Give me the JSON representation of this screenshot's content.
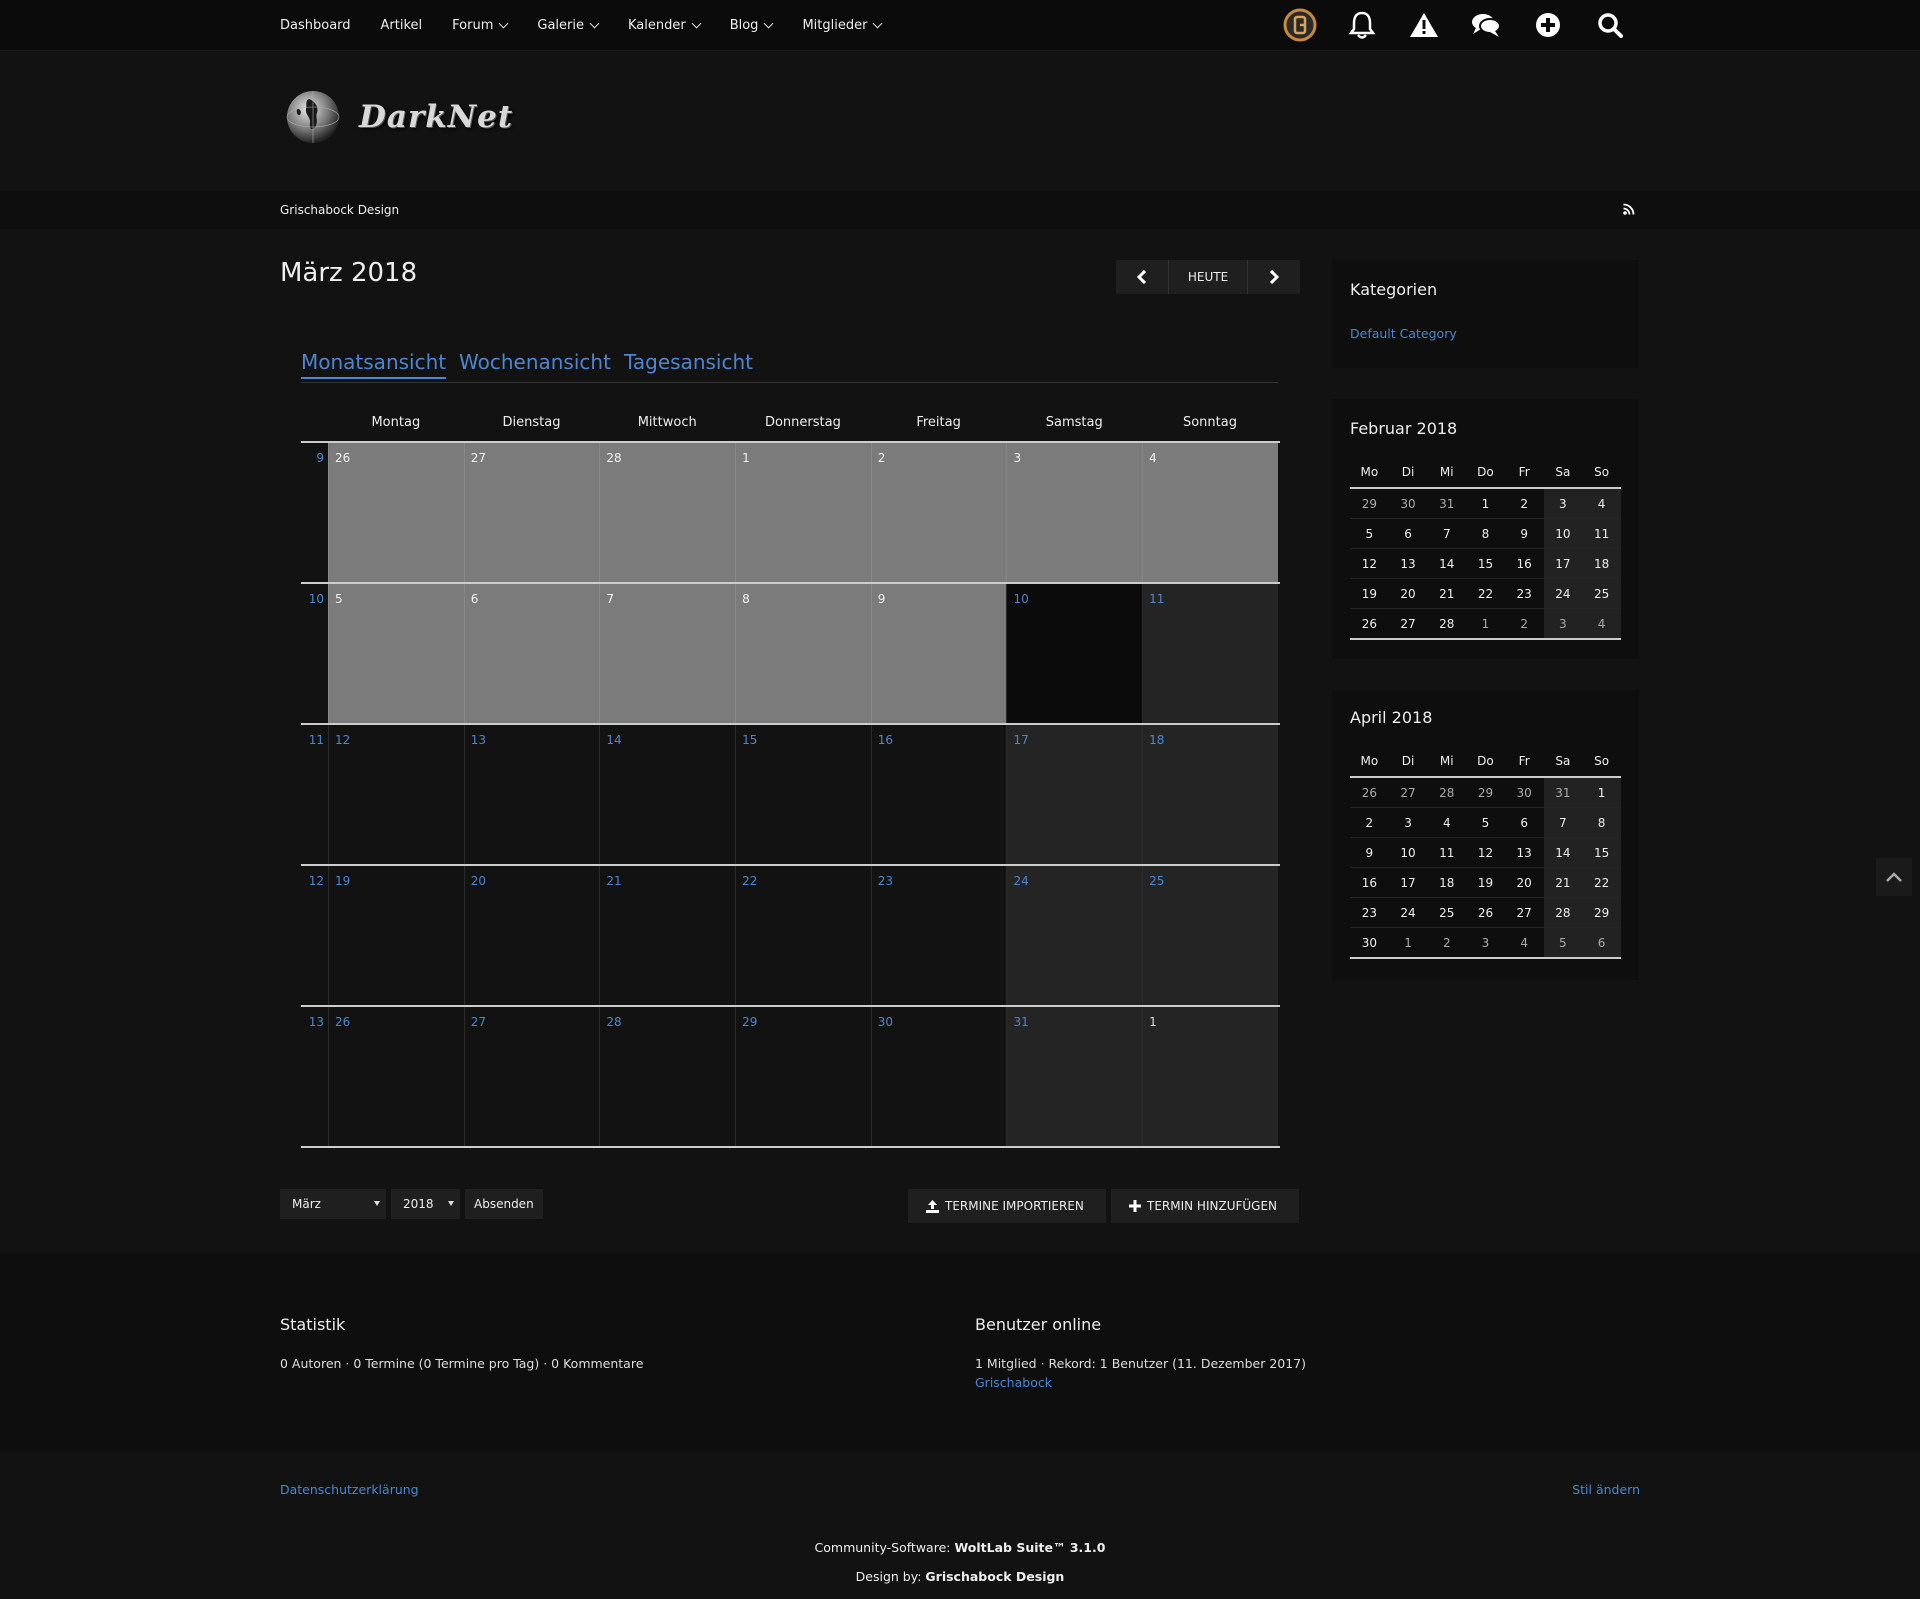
{
  "nav": {
    "items": [
      {
        "label": "Dashboard",
        "dropdown": false
      },
      {
        "label": "Artikel",
        "dropdown": false
      },
      {
        "label": "Forum",
        "dropdown": true
      },
      {
        "label": "Galerie",
        "dropdown": true
      },
      {
        "label": "Kalender",
        "dropdown": true
      },
      {
        "label": "Blog",
        "dropdown": true
      },
      {
        "label": "Mitglieder",
        "dropdown": true
      }
    ],
    "icons": [
      "user-avatar-icon",
      "bell-icon",
      "warning-icon",
      "chat-icon",
      "plus-icon",
      "search-icon"
    ]
  },
  "header": {
    "logo_text": "DarkNet"
  },
  "breadcrumb": {
    "label": "Grischabock Design"
  },
  "main": {
    "title": "März 2018",
    "today_label": "HEUTE",
    "tabs": [
      {
        "label": "Monatsansicht",
        "active": true
      },
      {
        "label": "Wochenansicht",
        "active": false
      },
      {
        "label": "Tagesansicht",
        "active": false
      }
    ],
    "day_names": [
      "Montag",
      "Dienstag",
      "Mittwoch",
      "Donnerstag",
      "Freitag",
      "Samstag",
      "Sonntag"
    ],
    "weeks": [
      {
        "num": "9",
        "days": [
          "26",
          "27",
          "28",
          "1",
          "2",
          "3",
          "4"
        ]
      },
      {
        "num": "10",
        "days": [
          "5",
          "6",
          "7",
          "8",
          "9",
          "10",
          "11"
        ]
      },
      {
        "num": "11",
        "days": [
          "12",
          "13",
          "14",
          "15",
          "16",
          "17",
          "18"
        ]
      },
      {
        "num": "12",
        "days": [
          "19",
          "20",
          "21",
          "22",
          "23",
          "24",
          "25"
        ]
      },
      {
        "num": "13",
        "days": [
          "26",
          "27",
          "28",
          "29",
          "30",
          "31",
          "1"
        ]
      }
    ],
    "form": {
      "month_value": "März",
      "year_value": "2018",
      "submit_label": "Absenden"
    },
    "import_label": "TERMINE IMPORTIEREN",
    "add_label": "TERMIN HINZUFÜGEN"
  },
  "sidebar": {
    "categories_title": "Kategorien",
    "category_link": "Default Category",
    "feb": {
      "title": "Februar 2018",
      "head": [
        "Mo",
        "Di",
        "Mi",
        "Do",
        "Fr",
        "Sa",
        "So"
      ],
      "rows": [
        [
          "29",
          "30",
          "31",
          "1",
          "2",
          "3",
          "4"
        ],
        [
          "5",
          "6",
          "7",
          "8",
          "9",
          "10",
          "11"
        ],
        [
          "12",
          "13",
          "14",
          "15",
          "16",
          "17",
          "18"
        ],
        [
          "19",
          "20",
          "21",
          "22",
          "23",
          "24",
          "25"
        ],
        [
          "26",
          "27",
          "28",
          "1",
          "2",
          "3",
          "4"
        ]
      ]
    },
    "apr": {
      "title": "April 2018",
      "head": [
        "Mo",
        "Di",
        "Mi",
        "Do",
        "Fr",
        "Sa",
        "So"
      ],
      "rows": [
        [
          "26",
          "27",
          "28",
          "29",
          "30",
          "31",
          "1"
        ],
        [
          "2",
          "3",
          "4",
          "5",
          "6",
          "7",
          "8"
        ],
        [
          "9",
          "10",
          "11",
          "12",
          "13",
          "14",
          "15"
        ],
        [
          "16",
          "17",
          "18",
          "19",
          "20",
          "21",
          "22"
        ],
        [
          "23",
          "24",
          "25",
          "26",
          "27",
          "28",
          "29"
        ],
        [
          "30",
          "1",
          "2",
          "3",
          "4",
          "5",
          "6"
        ]
      ]
    }
  },
  "stats": {
    "title": "Statistik",
    "text": "0 Autoren · 0 Termine (0 Termine pro Tag) · 0 Kommentare"
  },
  "online": {
    "title": "Benutzer online",
    "text": "1 Mitglied · Rekord: 1 Benutzer (11. Dezember 2017)",
    "user": "Grischabock"
  },
  "footer": {
    "privacy": "Datenschutzerklärung",
    "style": "Stil ändern",
    "software_prefix": "Community-Software: ",
    "software_name": "WoltLab Suite™ 3.1.0",
    "design_prefix": "Design by: ",
    "design_name": "Grischabock Design"
  },
  "colors": {
    "accent": "#4d86d0",
    "background": "#121212",
    "past_day": "#7b7b7b"
  }
}
